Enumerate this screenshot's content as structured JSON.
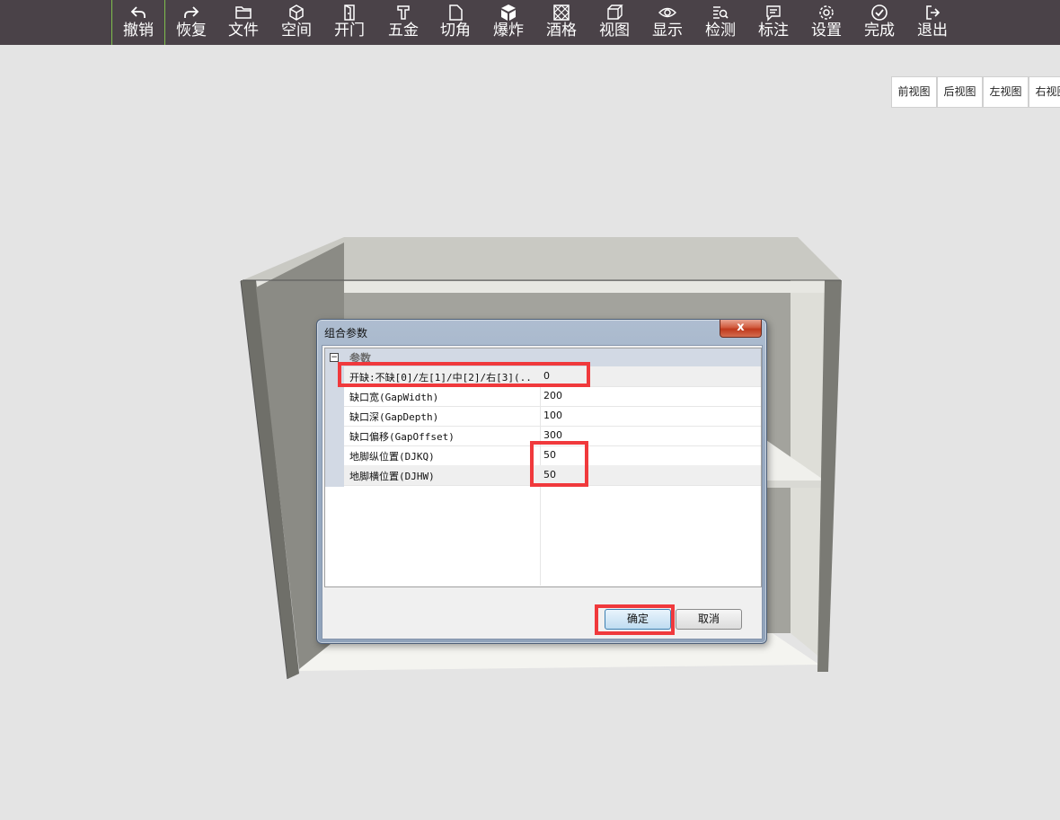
{
  "toolbar": {
    "items": [
      {
        "label": "撤销",
        "icon": "undo-icon"
      },
      {
        "label": "恢复",
        "icon": "redo-icon"
      },
      {
        "label": "文件",
        "icon": "folder-icon"
      },
      {
        "label": "空间",
        "icon": "cube-icon"
      },
      {
        "label": "开门",
        "icon": "door-icon"
      },
      {
        "label": "五金",
        "icon": "hardware-icon"
      },
      {
        "label": "切角",
        "icon": "cut-corner-icon"
      },
      {
        "label": "爆炸",
        "icon": "explode-icon"
      },
      {
        "label": "酒格",
        "icon": "wine-rack-icon"
      },
      {
        "label": "视图",
        "icon": "view-cube-icon"
      },
      {
        "label": "显示",
        "icon": "eye-icon"
      },
      {
        "label": "检测",
        "icon": "inspect-icon"
      },
      {
        "label": "标注",
        "icon": "annotation-icon"
      },
      {
        "label": "设置",
        "icon": "gear-icon"
      },
      {
        "label": "完成",
        "icon": "check-circle-icon"
      },
      {
        "label": "退出",
        "icon": "exit-icon"
      }
    ]
  },
  "views": [
    "前视图",
    "后视图",
    "左视图",
    "右视图"
  ],
  "dialog": {
    "title": "组合参数",
    "close": "x",
    "category": "参数",
    "toggle": "−",
    "rows": [
      {
        "name": "开缺:不缺[0]/左[1]/中[2]/右[3](..",
        "value": "0"
      },
      {
        "name": "缺口宽(GapWidth)",
        "value": "200"
      },
      {
        "name": "缺口深(GapDepth)",
        "value": "100"
      },
      {
        "name": "缺口偏移(GapOffset)",
        "value": "300"
      },
      {
        "name": "地脚纵位置(DJKQ)",
        "value": "50"
      },
      {
        "name": "地脚横位置(DJHW)",
        "value": "50"
      }
    ],
    "ok": "确定",
    "cancel": "取消"
  },
  "colors": {
    "toolbar_bg": "#4a4248",
    "highlight": "#f0393c",
    "cabinet_panel": "#909089"
  }
}
